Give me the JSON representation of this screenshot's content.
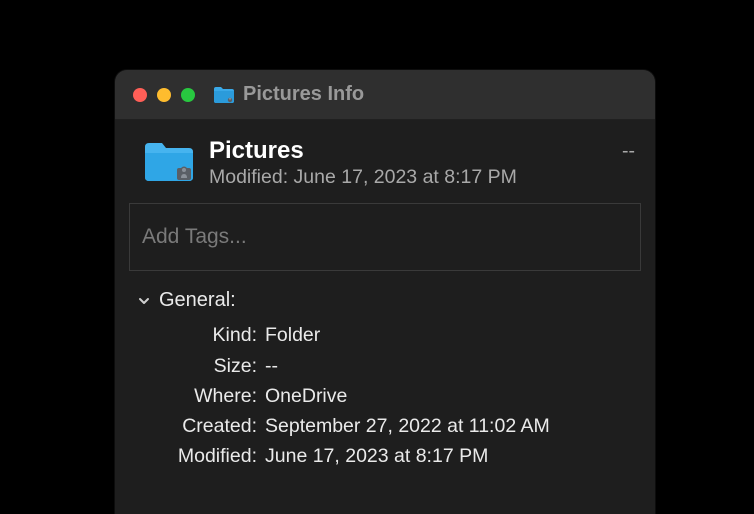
{
  "window": {
    "title": "Pictures Info"
  },
  "header": {
    "name": "Pictures",
    "modified_label": "Modified:",
    "modified_value": "June 17, 2023 at 8:17 PM",
    "size": "--"
  },
  "tags": {
    "placeholder": "Add Tags..."
  },
  "general": {
    "title": "General:",
    "rows": {
      "kind": {
        "label": "Kind:",
        "value": "Folder"
      },
      "size": {
        "label": "Size:",
        "value": "--"
      },
      "where": {
        "label": "Where:",
        "value": "OneDrive"
      },
      "created": {
        "label": "Created:",
        "value": "September 27, 2022 at 11:02 AM"
      },
      "modified": {
        "label": "Modified:",
        "value": "June 17, 2023 at 8:17 PM"
      }
    }
  }
}
